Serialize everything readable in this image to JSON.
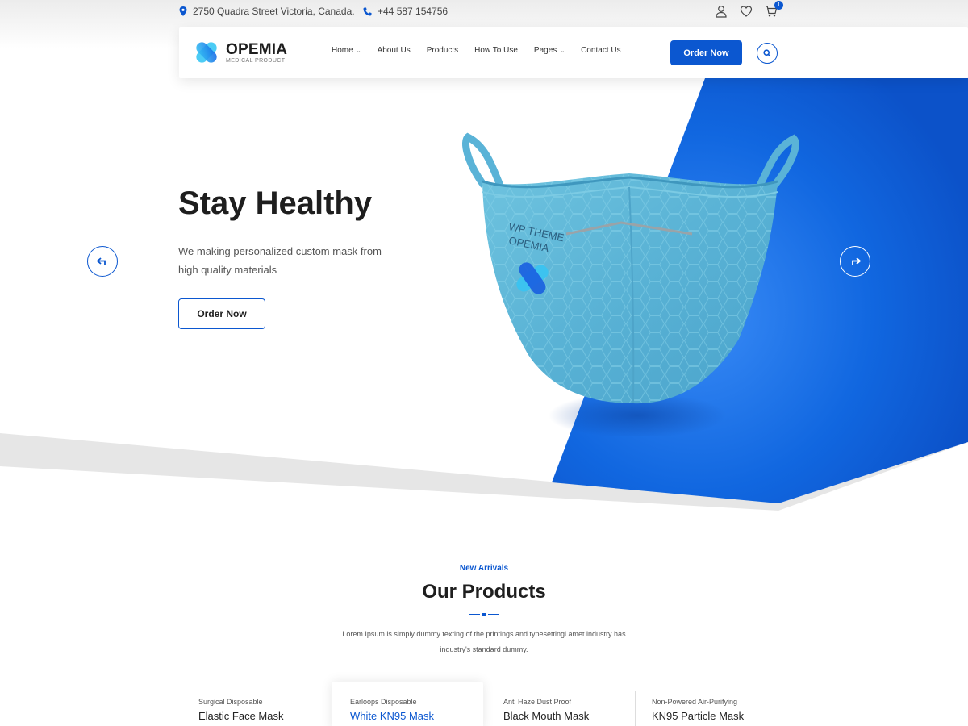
{
  "topbar": {
    "address": "2750 Quadra Street Victoria, Canada.",
    "phone": "+44 587 154756",
    "cart_count": "1",
    "icons": [
      "location-icon",
      "phone-icon",
      "user-icon",
      "heart-icon",
      "cart-icon"
    ]
  },
  "header": {
    "brand": "OPEMIA",
    "brand_sub": "MEDICAL PRODUCT",
    "nav": [
      {
        "label": "Home",
        "dropdown": true
      },
      {
        "label": "About Us",
        "dropdown": false
      },
      {
        "label": "Products",
        "dropdown": false
      },
      {
        "label": "How To Use",
        "dropdown": false
      },
      {
        "label": "Pages",
        "dropdown": true
      },
      {
        "label": "Contact Us",
        "dropdown": false
      }
    ],
    "order_label": "Order Now"
  },
  "hero": {
    "title": "Stay Healthy",
    "description": "We making personalized custom mask from high quality materials",
    "button_label": "Order Now",
    "mask_print_line1": "WP THEME",
    "mask_print_line2": "OPEMIA"
  },
  "products_section": {
    "kicker": "New Arrivals",
    "title": "Our Products",
    "description": "Lorem Ipsum is simply dummy texting of the printings and typesettingi amet industry has industry's standard dummy.",
    "items": [
      {
        "category": "Surgical Disposable",
        "name": "Elastic Face Mask"
      },
      {
        "category": "Earloops Disposable",
        "name": "White KN95 Mask"
      },
      {
        "category": "Anti Haze Dust Proof",
        "name": "Black Mouth Mask"
      },
      {
        "category": "Non-Powered Air-Purifying",
        "name": "KN95 Particle Mask"
      }
    ]
  },
  "colors": {
    "accent": "#0b57d0",
    "mask": "#5bb4d6",
    "text_dark": "#1e1e1e"
  }
}
